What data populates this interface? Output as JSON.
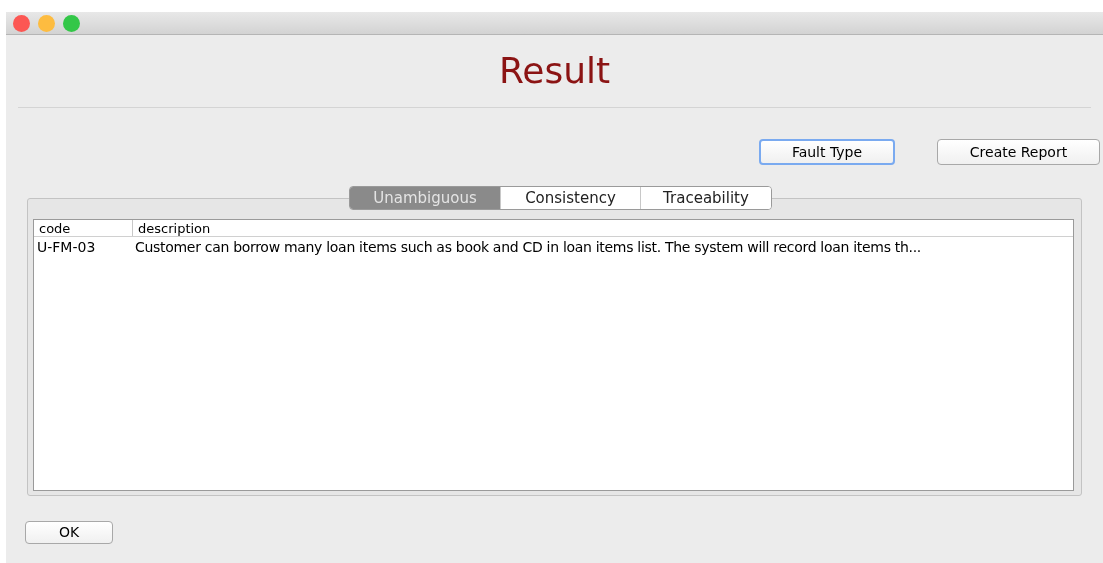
{
  "window": {
    "title": "Result"
  },
  "buttons": [
    {
      "label": "Fault Type",
      "focused": true
    },
    {
      "label": "Create Report",
      "focused": false
    }
  ],
  "tabs": [
    {
      "label": "Unambiguous",
      "selected": true
    },
    {
      "label": "Consistency",
      "selected": false
    },
    {
      "label": "Traceability",
      "selected": false
    }
  ],
  "table": {
    "columns": [
      "code",
      "description"
    ],
    "rows": [
      [
        "U-FM-03",
        "Customer can borrow many loan items such as book and CD in loan items list. The system will record loan items th..."
      ]
    ]
  },
  "ok_button": "OK"
}
